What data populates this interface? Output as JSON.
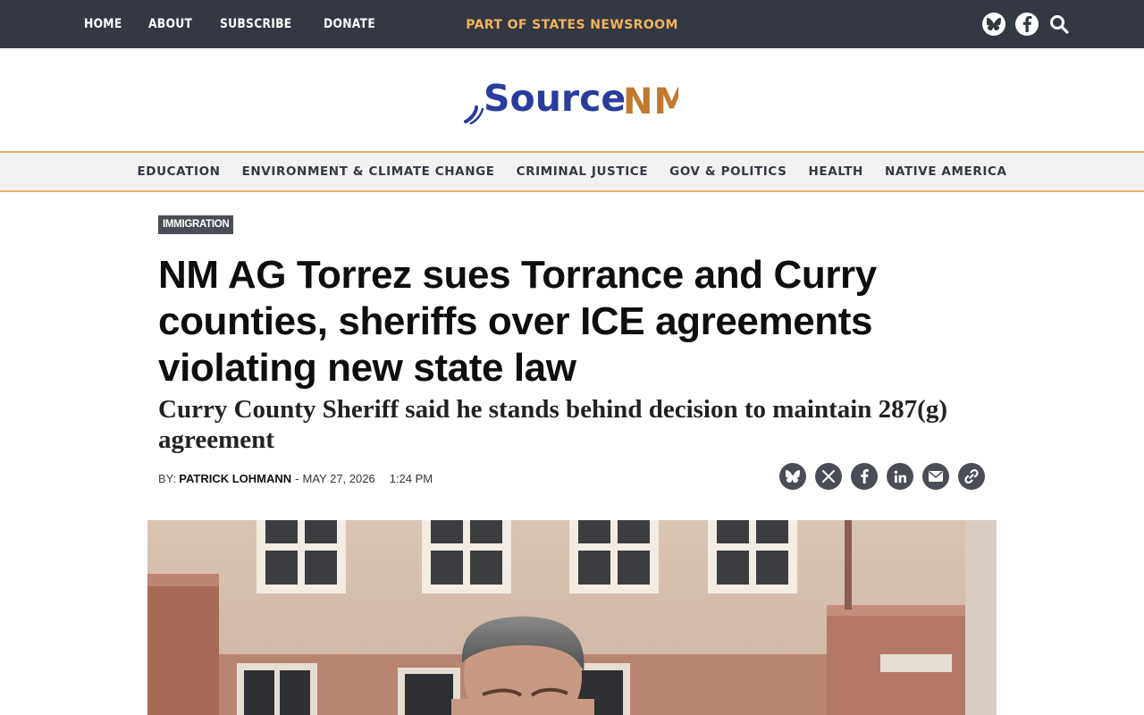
{
  "topbar": {
    "nav": [
      "HOME",
      "ABOUT",
      "SUBSCRIBE",
      "DONATE"
    ],
    "network_link": "PART OF STATES NEWSROOM",
    "icons": [
      "bluesky-icon",
      "facebook-icon",
      "search-icon"
    ]
  },
  "logo": {
    "word": "Source",
    "state": "NM"
  },
  "categories": [
    "EDUCATION",
    "ENVIRONMENT & CLIMATE CHANGE",
    "CRIMINAL JUSTICE",
    "GOV & POLITICS",
    "HEALTH",
    "NATIVE AMERICA"
  ],
  "article": {
    "tag": "IMMIGRATION",
    "headline": "NM AG Torrez sues Torrance and Curry counties, sheriffs over ICE agreements violating new state law",
    "subhead": "Curry County Sheriff said he stands behind decision to maintain 287(g) agreement",
    "byline_label": "BY:",
    "author": "PATRICK LOHMANN",
    "separator": "-",
    "date": "MAY 27, 2026",
    "time": "1:24 PM"
  },
  "share": [
    "bluesky-icon",
    "x-icon",
    "facebook-icon",
    "linkedin-icon",
    "email-icon",
    "link-icon"
  ],
  "colors": {
    "topbar": "#333842",
    "accent": "#f0b35a",
    "logo_blue": "#2a3c9c",
    "logo_orange": "#c07a30",
    "tag_bg": "#4a4d55"
  }
}
